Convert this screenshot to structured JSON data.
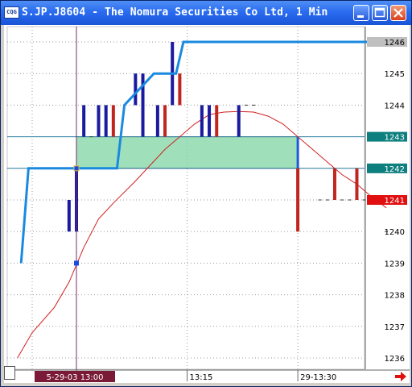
{
  "window": {
    "title": "S.JP.J8604 - The Nomura Securities Co Ltd, 1 Min",
    "app_icon_text": "CQG",
    "buttons": {
      "minimize": "minimize-icon",
      "maximize": "maximize-icon",
      "close": "close-icon"
    }
  },
  "chart_data": {
    "type": "bar",
    "symbol": "S.JP.J8604",
    "interval": "1 Min",
    "price_labels": [
      "1246",
      "1245",
      "1244",
      "1243",
      "1242",
      "1241",
      "1240",
      "1239",
      "1238",
      "1237",
      "1236"
    ],
    "price_highlights": [
      {
        "value": 1246,
        "label": "1246",
        "color": "#c0c0c0",
        "text_color": "#000000"
      },
      {
        "value": 1243,
        "label": "1243",
        "color": "#0e7f7f",
        "text_color": "#ffffff"
      },
      {
        "value": 1242,
        "label": "1242",
        "color": "#0e7f7f",
        "text_color": "#ffffff"
      },
      {
        "value": 1241,
        "label": "1241",
        "color": "#e01010",
        "text_color": "#ffffff"
      }
    ],
    "ylim": [
      1235.6,
      1246.4
    ],
    "time_labels": [
      {
        "label": "5-29-03 13:00",
        "slot": 0,
        "highlight": true
      },
      {
        "label": "13:15",
        "slot": 15,
        "highlight": false
      },
      {
        "label": "29-13:30",
        "slot": 30,
        "highlight": false
      }
    ],
    "bars": [
      {
        "slot": -1,
        "low": 1240.0,
        "high": 1241.0,
        "color": "#1a1a9e"
      },
      {
        "slot": 0,
        "low": 1240.0,
        "high": 1242.0,
        "color": "#1a1a9e"
      },
      {
        "slot": 1,
        "low": 1243.0,
        "high": 1244.0,
        "color": "#1a1a9e"
      },
      {
        "slot": 3,
        "low": 1243.0,
        "high": 1244.0,
        "color": "#1a1a9e"
      },
      {
        "slot": 4,
        "low": 1243.0,
        "high": 1244.0,
        "color": "#1a1a9e"
      },
      {
        "slot": 5,
        "low": 1243.0,
        "high": 1244.0,
        "color": "#c0261e"
      },
      {
        "slot": 8,
        "low": 1244.0,
        "high": 1245.0,
        "color": "#1a1a9e"
      },
      {
        "slot": 9,
        "low": 1243.0,
        "high": 1245.0,
        "color": "#1a1a9e"
      },
      {
        "slot": 11,
        "low": 1243.0,
        "high": 1244.0,
        "color": "#1a1a9e"
      },
      {
        "slot": 12,
        "low": 1243.0,
        "high": 1244.0,
        "color": "#c0261e"
      },
      {
        "slot": 13,
        "low": 1244.0,
        "high": 1246.0,
        "color": "#1a1a9e"
      },
      {
        "slot": 14,
        "low": 1244.0,
        "high": 1245.0,
        "color": "#c0261e"
      },
      {
        "slot": 17,
        "low": 1243.0,
        "high": 1244.0,
        "color": "#1a1a9e"
      },
      {
        "slot": 18,
        "low": 1243.0,
        "high": 1244.0,
        "color": "#1a1a9e"
      },
      {
        "slot": 19,
        "low": 1243.0,
        "high": 1244.0,
        "color": "#c0261e"
      },
      {
        "slot": 22,
        "low": 1243.0,
        "high": 1244.0,
        "color": "#1a1a9e"
      },
      {
        "slot": 30,
        "low": 1240.0,
        "high": 1242.0,
        "color": "#c0261e"
      },
      {
        "slot": 35,
        "low": 1241.0,
        "high": 1242.0,
        "color": "#c0261e"
      },
      {
        "slot": 38,
        "low": 1241.0,
        "high": 1242.0,
        "color": "#c0261e"
      }
    ],
    "ticks_only": [
      {
        "slot": 2,
        "price": 1243.0
      },
      {
        "slot": 23,
        "price": 1244.0
      },
      {
        "slot": 24,
        "price": 1244.0
      },
      {
        "slot": 33,
        "price": 1241.0
      },
      {
        "slot": 34,
        "price": 1241.0
      },
      {
        "slot": 36,
        "price": 1241.0
      },
      {
        "slot": 37,
        "price": 1241.0
      },
      {
        "slot": 39,
        "price": 1241.0
      },
      {
        "slot": 42,
        "price": 1240.0
      }
    ],
    "trend_line": {
      "color": "#1a8ae0",
      "points": [
        [
          -7.5,
          1239.0
        ],
        [
          -6.5,
          1242.0
        ],
        [
          5.5,
          1242.0
        ],
        [
          6.5,
          1244.0
        ],
        [
          10.5,
          1245.0
        ],
        [
          13.5,
          1245.0
        ],
        [
          14.5,
          1246.0
        ],
        [
          43,
          1246.0
        ]
      ]
    },
    "moving_average": {
      "color": "#d02020",
      "points": [
        [
          -8,
          1236.0
        ],
        [
          -6,
          1236.8
        ],
        [
          -3,
          1237.6
        ],
        [
          -1,
          1238.4
        ],
        [
          1,
          1239.5
        ],
        [
          3,
          1240.4
        ],
        [
          5,
          1240.9
        ],
        [
          8,
          1241.6
        ],
        [
          10,
          1242.1
        ],
        [
          12,
          1242.6
        ],
        [
          14,
          1243.0
        ],
        [
          16,
          1243.4
        ],
        [
          18,
          1243.7
        ],
        [
          20,
          1243.78
        ],
        [
          22,
          1243.8
        ],
        [
          24,
          1243.78
        ],
        [
          26,
          1243.65
        ],
        [
          28,
          1243.4
        ],
        [
          30,
          1243.0
        ],
        [
          32,
          1242.6
        ],
        [
          34,
          1242.2
        ],
        [
          36,
          1241.8
        ],
        [
          38,
          1241.5
        ],
        [
          40,
          1241.1
        ],
        [
          42,
          1240.75
        ]
      ]
    },
    "horizontal_lines": [
      {
        "price": 1243.0,
        "color": "#2a7f9f"
      },
      {
        "price": 1242.0,
        "color": "#2a7f9f"
      }
    ],
    "cursor_slot": 0,
    "zone": {
      "from_slot": 0,
      "to_slot": 30,
      "low": 1242.0,
      "high": 1243.0,
      "color": "#7fd6a4"
    },
    "grid": true
  }
}
